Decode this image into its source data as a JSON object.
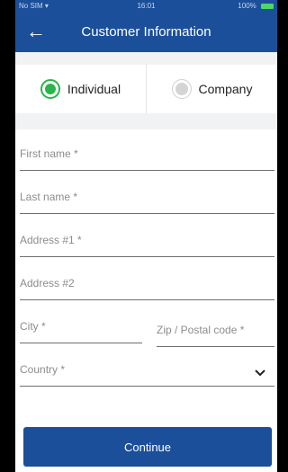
{
  "status_bar": {
    "carrier": "No SIM",
    "time": "16:01",
    "battery": "100%"
  },
  "header": {
    "title": "Customer Information"
  },
  "customer_type": {
    "options": [
      {
        "label": "Individual",
        "selected": true
      },
      {
        "label": "Company",
        "selected": false
      }
    ]
  },
  "form": {
    "first_name": "First name *",
    "last_name": "Last name *",
    "address1": "Address #1 *",
    "address2": "Address #2",
    "city": "City *",
    "zip": "Zip / Postal code *",
    "country": "Country *"
  },
  "actions": {
    "continue": "Continue"
  },
  "colors": {
    "brand": "#1b4f9a",
    "radio_selected": "#2ab54a"
  }
}
